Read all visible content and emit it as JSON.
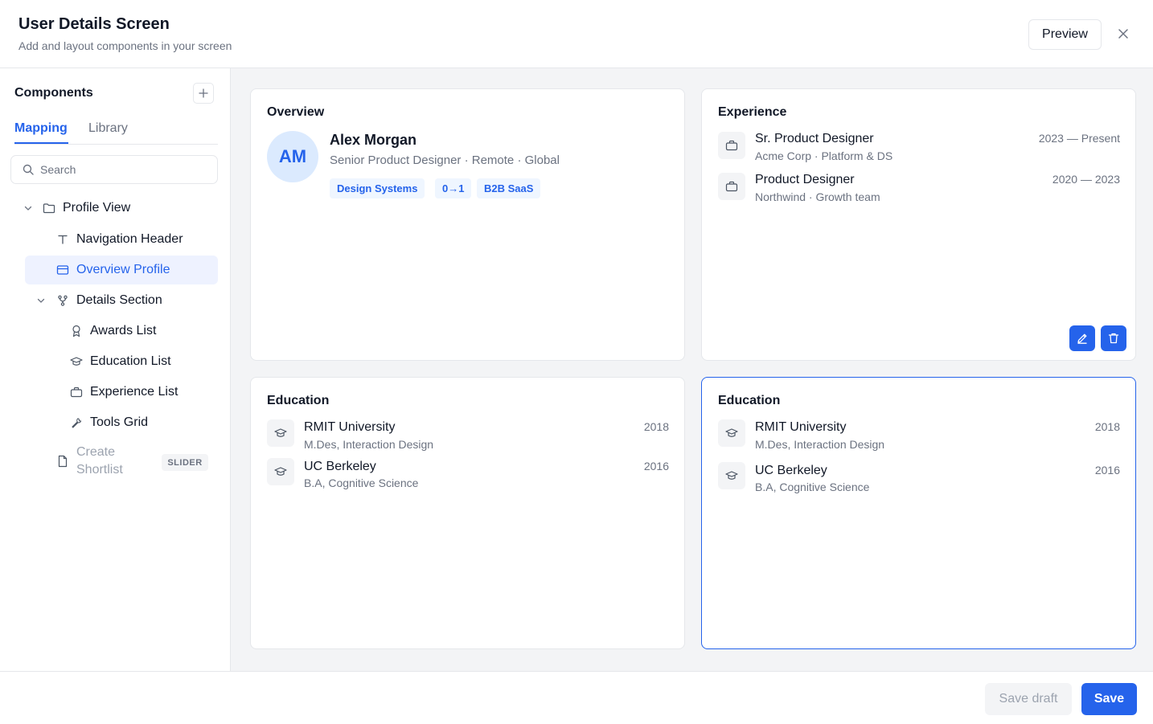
{
  "header": {
    "title": "User Details Screen",
    "subtitle": "Add and layout components in your screen",
    "preview_label": "Preview"
  },
  "sidebar": {
    "title": "Components",
    "tabs": [
      {
        "label": "Mapping",
        "active": true
      },
      {
        "label": "Library",
        "active": false
      }
    ],
    "search_placeholder": "Search",
    "tree": [
      {
        "label": "Profile View",
        "icon": "folder-icon",
        "expanded": true
      },
      {
        "label": "Navigation Header",
        "icon": "text-icon"
      },
      {
        "label": "Overview Profile",
        "icon": "card-icon",
        "selected": true
      },
      {
        "label": "Details Section",
        "icon": "branch-icon",
        "expanded": true
      },
      {
        "label": "Awards List",
        "icon": "award-icon"
      },
      {
        "label": "Education List",
        "icon": "graduation-cap-icon"
      },
      {
        "label": "Experience List",
        "icon": "briefcase-icon"
      },
      {
        "label": "Tools Grid",
        "icon": "wrench-icon"
      },
      {
        "label": "Create Shortlist",
        "line1": "Create",
        "line2": "Shortlist",
        "icon": "file-icon",
        "badge": "SLIDER"
      }
    ]
  },
  "cards": {
    "overview": {
      "title": "Overview",
      "initials": "AM",
      "name": "Alex Morgan",
      "role": "Senior Product Designer · Remote · Global",
      "chips": [
        "Design Systems",
        "0→1",
        "B2B SaaS"
      ]
    },
    "experience": {
      "title": "Experience",
      "items": [
        {
          "title": "Sr. Product Designer",
          "sub": "Acme Corp · Platform & DS",
          "date": "2023 — Present"
        },
        {
          "title": "Product Designer",
          "sub": "Northwind · Growth team",
          "date": "2020 — 2023"
        }
      ]
    },
    "education_a": {
      "title": "Education",
      "items": [
        {
          "title": "RMIT University",
          "sub": "M.Des, Interaction Design",
          "date": "2018"
        },
        {
          "title": "UC Berkeley",
          "sub": "B.A, Cognitive Science",
          "date": "2016"
        }
      ]
    },
    "education_b": {
      "title": "Education",
      "items": [
        {
          "title": "RMIT University",
          "sub": "M.Des, Interaction Design",
          "date": "2018"
        },
        {
          "title": "UC Berkeley",
          "sub": "B.A, Cognitive Science",
          "date": "2016"
        }
      ]
    }
  },
  "footer": {
    "save_draft_label": "Save draft",
    "save_label": "Save"
  },
  "colors": {
    "accent": "#2563eb",
    "accent_soft": "#eff6ff",
    "canvas_bg": "#f3f4f6",
    "border": "#e5e7eb",
    "muted_text": "#6b7280"
  }
}
